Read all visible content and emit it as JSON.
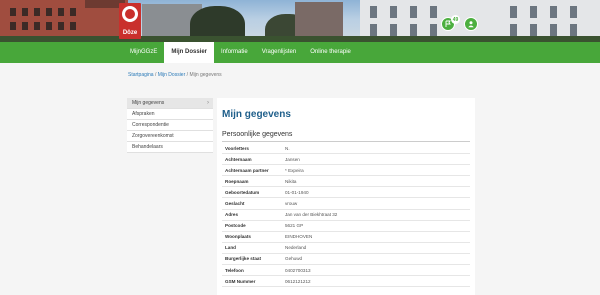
{
  "brand": {
    "logo_text": "Dôze",
    "color": "#c9302c"
  },
  "header": {
    "notification_count": "49"
  },
  "nav": {
    "items": [
      {
        "label": "MijnGGzE",
        "active": false
      },
      {
        "label": "Mijn Dossier",
        "active": true
      },
      {
        "label": "Informatie",
        "active": false
      },
      {
        "label": "Vragenlijsten",
        "active": false
      },
      {
        "label": "Online therapie",
        "active": false
      }
    ],
    "color": "#48a73a"
  },
  "breadcrumb": {
    "home": "Startpagina",
    "level2": "Mijn Dossier",
    "current": "Mijn gegevens",
    "sep": " / "
  },
  "sidebar": {
    "items": [
      {
        "label": "Mijn gegevens",
        "active": true
      },
      {
        "label": "Afspraken",
        "active": false
      },
      {
        "label": "Correspondentie",
        "active": false
      },
      {
        "label": "Zorgovereenkomst",
        "active": false
      },
      {
        "label": "Behandelaars",
        "active": false
      }
    ]
  },
  "main": {
    "title": "Mijn gegevens",
    "section": "Persoonlijke gegevens",
    "rows": [
      {
        "label": "Voorletters",
        "value": "N."
      },
      {
        "label": "Achternaam",
        "value": "Jansen"
      },
      {
        "label": "Achternaam partner",
        "value": "* Expeira"
      },
      {
        "label": "Roepnaam",
        "value": "Nikita"
      },
      {
        "label": "Geboortedatum",
        "value": "01-01-1940"
      },
      {
        "label": "Geslacht",
        "value": "vrouw"
      },
      {
        "label": "Adres",
        "value": "Jan van der Biekhtraat 32"
      },
      {
        "label": "Postcode",
        "value": "5621 GP"
      },
      {
        "label": "Woonplaats",
        "value": "EINDHOVEN"
      },
      {
        "label": "Land",
        "value": "Nederland"
      },
      {
        "label": "Burgerlijke staat",
        "value": "Gehuwd"
      },
      {
        "label": "Telefoon",
        "value": "0402700313"
      },
      {
        "label": "GSM Nummer",
        "value": "0612121212"
      }
    ]
  }
}
